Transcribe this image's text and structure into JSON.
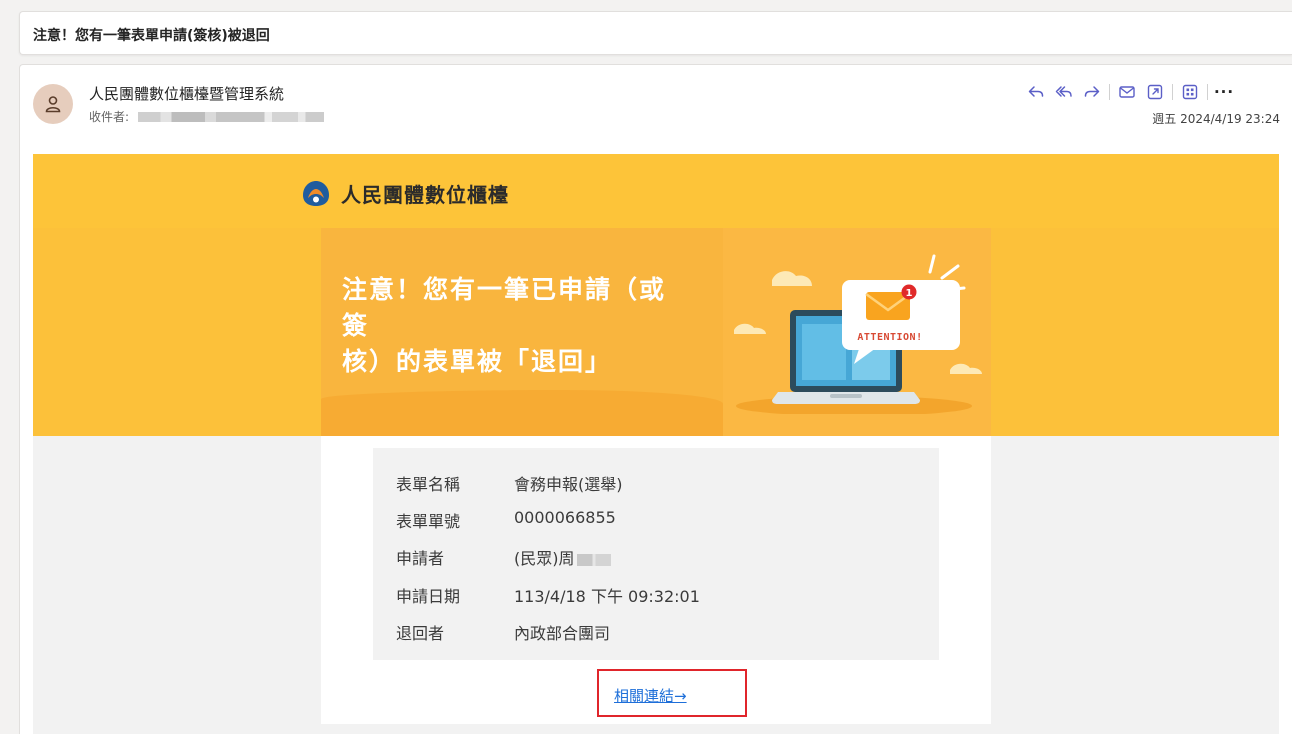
{
  "subject": "注意！您有一筆表單申請(簽核)被退回",
  "sender": {
    "name": "人民團體數位櫃檯暨管理系統",
    "recipient_label": "收件者:"
  },
  "timestamp": "週五 2024/4/19 23:24",
  "actions": {
    "icons": [
      "reply-icon",
      "reply-all-icon",
      "forward-icon",
      "mail-icon",
      "open-external-icon",
      "apps-icon",
      "more-icon"
    ],
    "more_label": "···"
  },
  "email": {
    "brand": "人民團體數位櫃檯",
    "headline_line1": "注意！您有一筆已申請（或簽",
    "headline_line2": "核）的表單被「退回」",
    "illustration_text": "ATTENTION!",
    "notification_badge": "1",
    "fields": [
      {
        "label": "表單名稱",
        "value": "會務申報(選舉)"
      },
      {
        "label": "表單單號",
        "value": "0000066855"
      },
      {
        "label": "申請者",
        "value": "(民眾)周"
      },
      {
        "label": "申請日期",
        "value": "113/4/18 下午 09:32:01"
      },
      {
        "label": "退回者",
        "value": "內政部合團司"
      }
    ],
    "link_text": "相關連結→"
  },
  "colors": {
    "banner_yellow": "#fdc439",
    "accent": "#5b5fc7",
    "link": "#1e6fd9",
    "highlight_frame": "#e0252b"
  }
}
